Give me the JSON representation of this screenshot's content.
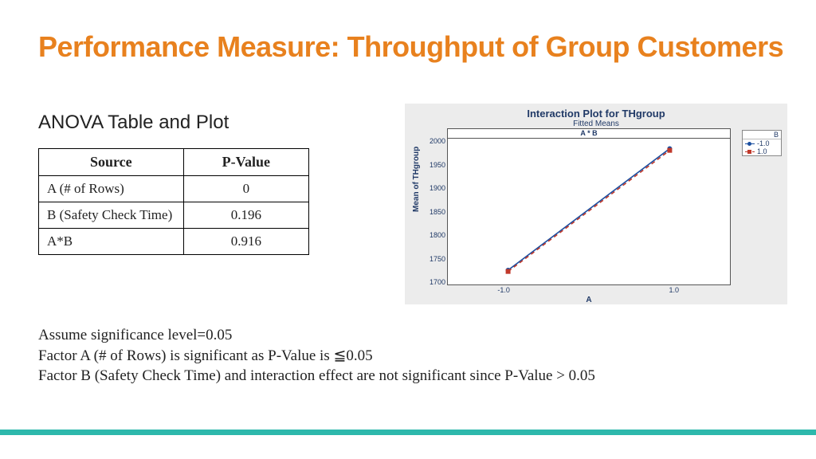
{
  "title": "Performance Measure: Throughput of Group Customers",
  "subhead": "ANOVA Table and Plot",
  "table": {
    "headers": {
      "source": "Source",
      "pvalue": "P-Value"
    },
    "rows": [
      {
        "source": "A (# of Rows)",
        "pvalue": "0"
      },
      {
        "source": "B (Safety Check Time)",
        "pvalue": "0.196"
      },
      {
        "source": "A*B",
        "pvalue": "0.916"
      }
    ]
  },
  "notes": {
    "l1": "Assume significance level=0.05",
    "l2": "Factor A (# of Rows) is significant as P-Value is ≦0.05",
    "l3": "Factor B (Safety Check Time) and interaction effect are not significant since P-Value > 0.05"
  },
  "chart_data": {
    "type": "line",
    "title": "Interaction Plot for THgroup",
    "subtitle": "Fitted Means",
    "panel_label": "A * B",
    "xlabel": "A",
    "ylabel": "Mean of THgroup",
    "x": [
      -1.0,
      1.0
    ],
    "ylim": [
      1700,
      2000
    ],
    "yticks": [
      1700,
      1750,
      1800,
      1850,
      1900,
      1950,
      2000
    ],
    "xticks_labels": [
      "-1.0",
      "1.0"
    ],
    "legend_title": "B",
    "series": [
      {
        "name": "-1.0",
        "values": [
          1718,
          1992
        ],
        "color": "#1a4ea0",
        "style": "solid",
        "marker": "circle"
      },
      {
        "name": "1.0",
        "values": [
          1715,
          1988
        ],
        "color": "#c0392b",
        "style": "dashed",
        "marker": "square"
      }
    ]
  }
}
